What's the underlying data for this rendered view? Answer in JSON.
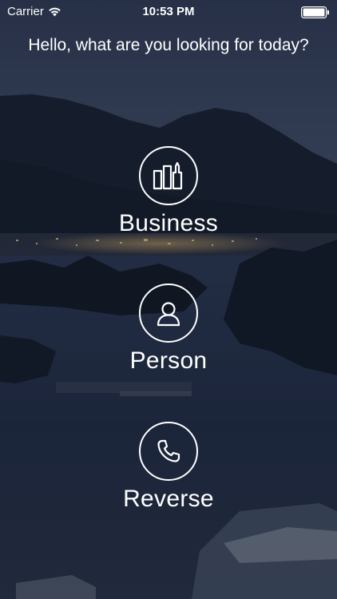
{
  "status_bar": {
    "carrier": "Carrier",
    "time": "10:53 PM",
    "wifi_icon": "wifi-icon",
    "battery_icon": "battery-icon"
  },
  "greeting": "Hello, what are you looking for today?",
  "options": [
    {
      "label": "Business",
      "icon": "buildings-icon"
    },
    {
      "label": "Person",
      "icon": "person-icon"
    },
    {
      "label": "Reverse",
      "icon": "phone-icon"
    }
  ],
  "colors": {
    "foreground": "#ffffff",
    "sky": "#3a4560",
    "water": "#1e2a3d"
  }
}
